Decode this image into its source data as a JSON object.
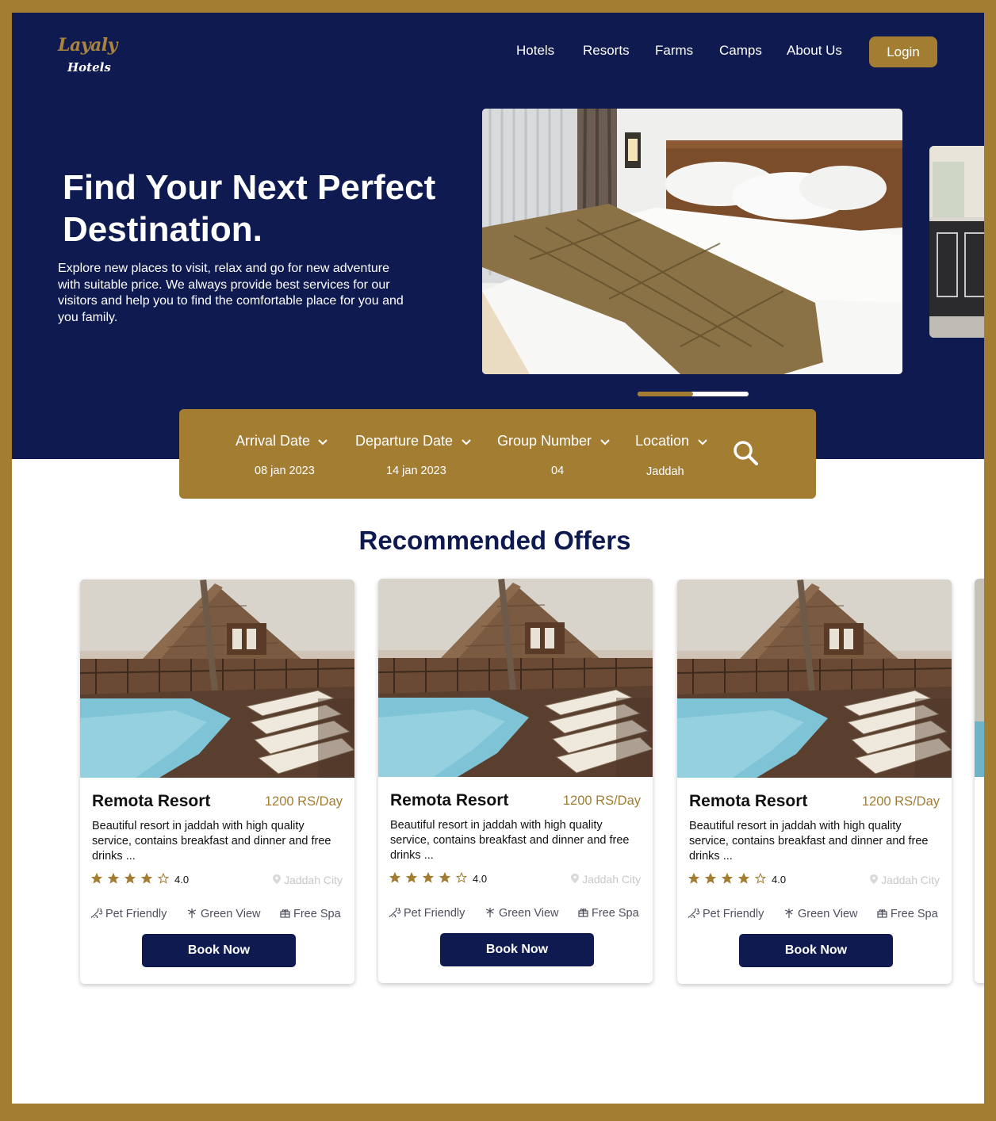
{
  "brand": {
    "name_line1": "Layaly",
    "name_line2": "Hotels"
  },
  "nav": {
    "items": [
      {
        "label": "Hotels"
      },
      {
        "label": "Resorts"
      },
      {
        "label": "Farms"
      },
      {
        "label": "Camps"
      },
      {
        "label": "About Us"
      }
    ],
    "login_label": "Login"
  },
  "hero": {
    "title": "Find Your Next Perfect Destination.",
    "description": "Explore new places to visit, relax and go for new adventure with suitable price. We always provide best services for our visitors and help you to find the comfortable place for you and you  family.",
    "carousel_progress": 0.5
  },
  "search": {
    "fields": [
      {
        "label": "Arrival Date",
        "value": "08 jan 2023"
      },
      {
        "label": "Departure Date",
        "value": "14 jan 2023"
      },
      {
        "label": "Group Number",
        "value": "04"
      },
      {
        "label": "Location",
        "value": "Jaddah"
      }
    ]
  },
  "offers": {
    "title": "Recommended Offers",
    "cards": [
      {
        "name": "Remota Resort",
        "price": "1200 RS/Day",
        "description": "Beautiful resort in jaddah with high quality service, contains breakfast and dinner and free drinks ...",
        "stars": 4,
        "rating": "4.0",
        "location": "Jaddah City",
        "amenities": [
          "Pet Friendly",
          "Green View",
          "Free Spa"
        ],
        "button": "Book Now"
      },
      {
        "name": "Remota Resort",
        "price": "1200 RS/Day",
        "description": "Beautiful resort in jaddah with high quality service, contains breakfast and dinner and free drinks ...",
        "stars": 4,
        "rating": "4.0",
        "location": "Jaddah City",
        "amenities": [
          "Pet Friendly",
          "Green View",
          "Free Spa"
        ],
        "button": "Book Now"
      },
      {
        "name": "Remota Resort",
        "price": "1200 RS/Day",
        "description": "Beautiful resort in jaddah with high quality service, contains breakfast and dinner and free drinks ...",
        "stars": 4,
        "rating": "4.0",
        "location": "Jaddah City",
        "amenities": [
          "Pet Friendly",
          "Green View",
          "Free Spa"
        ],
        "button": "Book Now"
      }
    ]
  },
  "colors": {
    "navy": "#0f1b50",
    "gold": "#a27d32",
    "white": "#ffffff"
  }
}
